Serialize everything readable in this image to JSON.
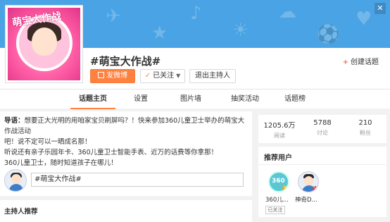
{
  "banner": {
    "close_glyph": "✕"
  },
  "avatar": {
    "title_text": "萌宝大作战"
  },
  "topic": {
    "title": "#萌宝大作战#",
    "create_label": "创建话题",
    "create_icon": "+"
  },
  "actions": {
    "post_label": "发微博",
    "follow_label": "已关注",
    "exit_host_label": "退出主持人"
  },
  "tabs": [
    "话题主页",
    "设置",
    "图片墙",
    "抽奖活动",
    "话题榜"
  ],
  "intro": {
    "label": "导语：",
    "lines": [
      "想要正大光明的用咱家宝贝刷屏吗？！快来参加360儿童卫士举办的萌宝大作战活动",
      "吧！说不定可以一晒成名那！",
      "听说还有亲子乐园年卡、360儿童卫士智能手表、近万的话费等你拿那！",
      "360儿童卫士，随时知道孩子在哪儿！"
    ]
  },
  "compose": {
    "value": "#萌宝大作战#"
  },
  "host_section": {
    "title": "主持人推荐"
  },
  "stats": [
    {
      "value": "1205.6万",
      "label": "阅读"
    },
    {
      "value": "5788",
      "label": "讨论"
    },
    {
      "value": "210",
      "label": "粉丝"
    }
  ],
  "recommend": {
    "title": "推荐用户",
    "users": [
      {
        "name": "360儿...",
        "avatar_text": "360",
        "followed_label": "已关注"
      },
      {
        "name": "神奇D..."
      }
    ]
  },
  "colors": {
    "accent": "#ff8140",
    "banner": "#4aa3e4"
  }
}
